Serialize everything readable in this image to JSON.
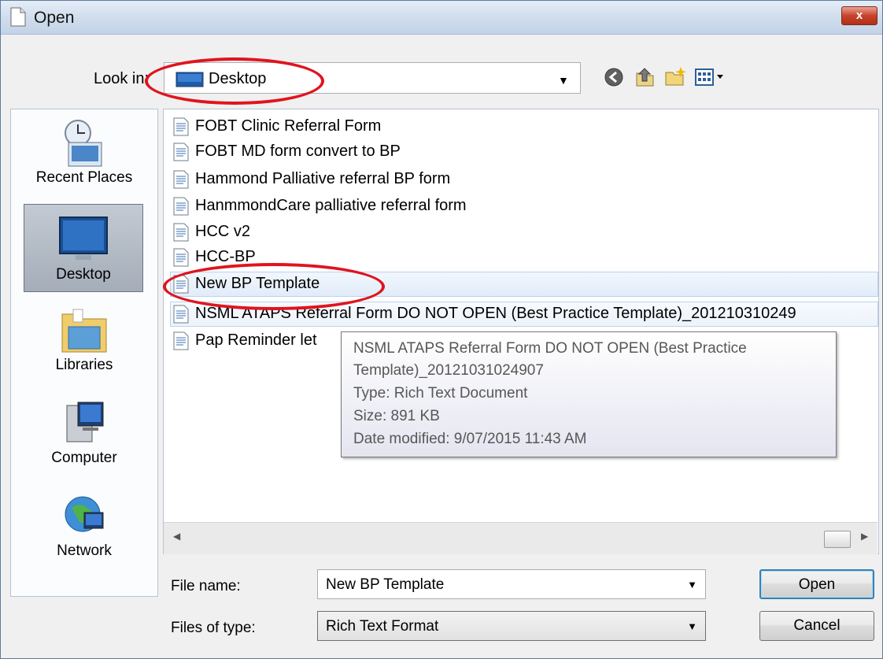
{
  "window": {
    "title": "Open",
    "close_glyph": "x"
  },
  "lookin": {
    "label": "Look in:",
    "value": "Desktop"
  },
  "toolbar": [
    {
      "name": "back-icon"
    },
    {
      "name": "up-folder-icon"
    },
    {
      "name": "new-folder-icon"
    },
    {
      "name": "view-menu-icon"
    }
  ],
  "places": [
    {
      "label": "Recent Places",
      "icon": "recent-places-icon"
    },
    {
      "label": "Desktop",
      "icon": "desktop-icon",
      "selected": true
    },
    {
      "label": "Libraries",
      "icon": "libraries-icon"
    },
    {
      "label": "Computer",
      "icon": "computer-icon"
    },
    {
      "label": "Network",
      "icon": "network-icon"
    }
  ],
  "files": [
    "FOBT Clinic Referral Form",
    "FOBT MD form convert to BP",
    "Hammond Palliative referral BP form",
    "HanmmondCare palliative referral form",
    "HCC v2",
    "HCC-BP",
    "New BP Template",
    "NSML ATAPS Referral Form DO NOT OPEN (Best Practice Template)_201210310249",
    "Pap Reminder let"
  ],
  "tooltip": {
    "line1": "NSML ATAPS Referral Form DO NOT OPEN (Best Practice",
    "line2": "Template)_20121031024907",
    "type": "Type: Rich Text Document",
    "size": "Size: 891 KB",
    "date": "Date modified: 9/07/2015 11:43 AM"
  },
  "filename": {
    "label": "File name:",
    "value": "New BP Template"
  },
  "filetype": {
    "label": "Files of type:",
    "value": "Rich Text Format"
  },
  "buttons": {
    "open": "Open",
    "cancel": "Cancel"
  },
  "colors": {
    "highlight": "#e0141e",
    "title_bar": "#cfdcec",
    "close_button": "#c7432b"
  }
}
